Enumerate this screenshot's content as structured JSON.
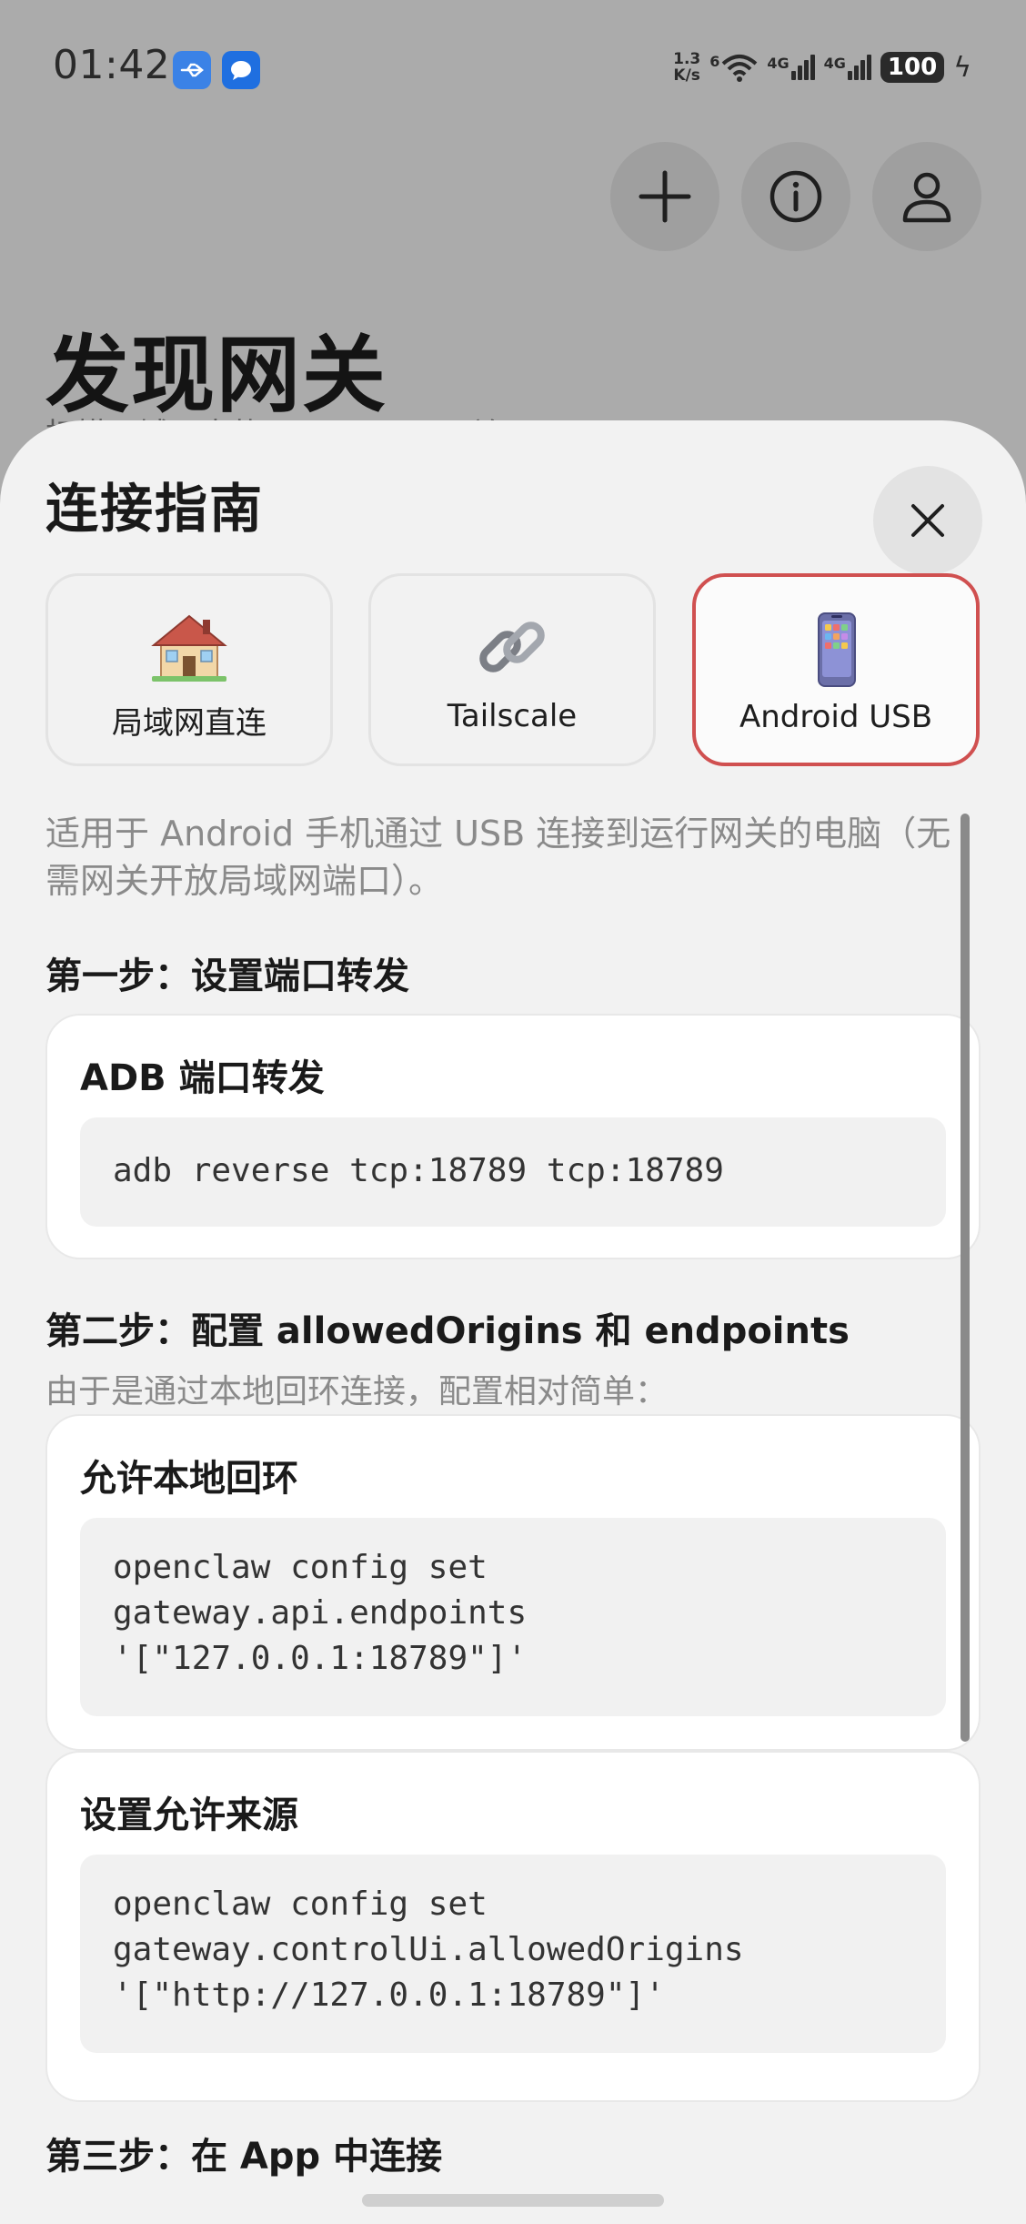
{
  "status_bar": {
    "time": "01:42",
    "net_speed_value": "1.3",
    "net_speed_unit": "K/s",
    "wifi_tag": "6",
    "signal_1_tag": "4G",
    "signal_2_tag": "4G",
    "battery": "100",
    "notifications": [
      "usb-icon",
      "message-icon"
    ]
  },
  "background_page": {
    "title": "发现网关",
    "subtitle": "扫描局域网中的 OpenClaw 网关"
  },
  "sheet": {
    "title": "连接指南",
    "tabs": [
      {
        "label": "局域网直连",
        "icon": "house-icon"
      },
      {
        "label": "Tailscale",
        "icon": "link-icon"
      },
      {
        "label": "Android USB",
        "icon": "phone-icon",
        "selected": true
      }
    ],
    "description": "适用于 Android 手机通过 USB 连接到运行网关的电脑（无需网关开放局域网端口）。",
    "step1": {
      "title": "第一步：设置端口转发",
      "card_title": "ADB 端口转发",
      "code": "adb reverse tcp:18789 tcp:18789"
    },
    "step2": {
      "title": "第二步：配置 allowedOrigins 和 endpoints",
      "note": "由于是通过本地回环连接，配置相对简单：",
      "cards": [
        {
          "title": "允许本地回环",
          "code": "openclaw config set\ngateway.api.endpoints\n'[\"127.0.0.1:18789\"]'"
        },
        {
          "title": "设置允许来源",
          "code": "openclaw config set\ngateway.controlUi.allowedOrigins\n'[\"http://127.0.0.1:18789\"]'"
        }
      ]
    },
    "step3": {
      "title": "第三步：在 App 中连接"
    }
  },
  "colors": {
    "selected_tab_border": "#d05050",
    "sheet_background": "#f2f2f2",
    "scrim": "#ababab"
  }
}
